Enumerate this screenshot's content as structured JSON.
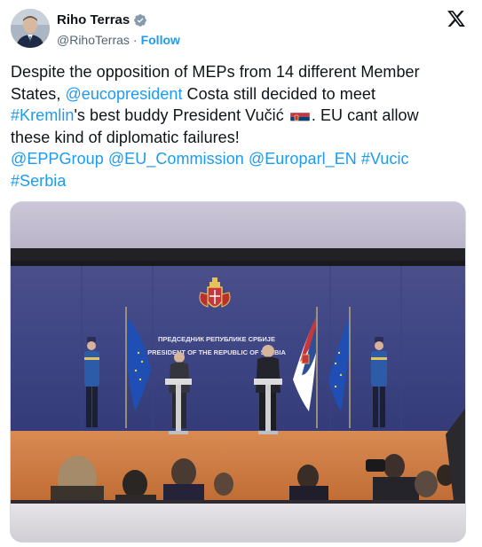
{
  "author": {
    "display_name": "Riho Terras",
    "handle": "@RihoTerras",
    "separator": "·",
    "follow_label": "Follow"
  },
  "tweet": {
    "line1_a": "Despite the opposition of MEPs from 14 different Member",
    "line2_a": "States, ",
    "mention_eucopresident": "@eucopresident",
    "line2_b": " Costa still decided to meet",
    "hashtag_kremlin": "#Kremlin",
    "line3_b": "'s best buddy President Vučić",
    "line3_c": ". EU cant allow",
    "line4": "these kind of diplomatic failures!",
    "mention_epp": "@EPPGroup",
    "mention_commission": "@EU_Commission",
    "mention_europarl": "@Europarl_EN",
    "hashtag_vucic": "#Vucic",
    "hashtag_serbia": "#Serbia"
  },
  "media": {
    "backdrop_line1": "ПРЕДСЕДНИК РЕПУБЛИКЕ СРБИЈЕ",
    "backdrop_line2": "PRESIDENT OF THE REPUBLIC OF SERBIA"
  },
  "colors": {
    "link": "#1d9bf0",
    "text": "#0f1419",
    "secondary": "#536471",
    "verified_badge": "#829aab"
  },
  "icons": {
    "verified": "verified-badge-icon",
    "logo": "x-logo-icon",
    "flag": "serbia-flag-emoji"
  }
}
